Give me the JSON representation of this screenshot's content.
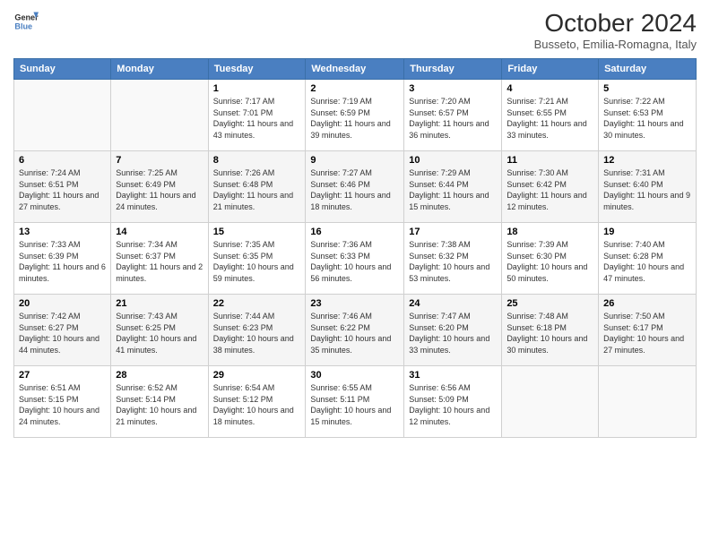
{
  "logo": {
    "line1": "General",
    "line2": "Blue"
  },
  "title": "October 2024",
  "location": "Busseto, Emilia-Romagna, Italy",
  "days_of_week": [
    "Sunday",
    "Monday",
    "Tuesday",
    "Wednesday",
    "Thursday",
    "Friday",
    "Saturday"
  ],
  "weeks": [
    [
      {
        "day": "",
        "info": ""
      },
      {
        "day": "",
        "info": ""
      },
      {
        "day": "1",
        "info": "Sunrise: 7:17 AM\nSunset: 7:01 PM\nDaylight: 11 hours and 43 minutes."
      },
      {
        "day": "2",
        "info": "Sunrise: 7:19 AM\nSunset: 6:59 PM\nDaylight: 11 hours and 39 minutes."
      },
      {
        "day": "3",
        "info": "Sunrise: 7:20 AM\nSunset: 6:57 PM\nDaylight: 11 hours and 36 minutes."
      },
      {
        "day": "4",
        "info": "Sunrise: 7:21 AM\nSunset: 6:55 PM\nDaylight: 11 hours and 33 minutes."
      },
      {
        "day": "5",
        "info": "Sunrise: 7:22 AM\nSunset: 6:53 PM\nDaylight: 11 hours and 30 minutes."
      }
    ],
    [
      {
        "day": "6",
        "info": "Sunrise: 7:24 AM\nSunset: 6:51 PM\nDaylight: 11 hours and 27 minutes."
      },
      {
        "day": "7",
        "info": "Sunrise: 7:25 AM\nSunset: 6:49 PM\nDaylight: 11 hours and 24 minutes."
      },
      {
        "day": "8",
        "info": "Sunrise: 7:26 AM\nSunset: 6:48 PM\nDaylight: 11 hours and 21 minutes."
      },
      {
        "day": "9",
        "info": "Sunrise: 7:27 AM\nSunset: 6:46 PM\nDaylight: 11 hours and 18 minutes."
      },
      {
        "day": "10",
        "info": "Sunrise: 7:29 AM\nSunset: 6:44 PM\nDaylight: 11 hours and 15 minutes."
      },
      {
        "day": "11",
        "info": "Sunrise: 7:30 AM\nSunset: 6:42 PM\nDaylight: 11 hours and 12 minutes."
      },
      {
        "day": "12",
        "info": "Sunrise: 7:31 AM\nSunset: 6:40 PM\nDaylight: 11 hours and 9 minutes."
      }
    ],
    [
      {
        "day": "13",
        "info": "Sunrise: 7:33 AM\nSunset: 6:39 PM\nDaylight: 11 hours and 6 minutes."
      },
      {
        "day": "14",
        "info": "Sunrise: 7:34 AM\nSunset: 6:37 PM\nDaylight: 11 hours and 2 minutes."
      },
      {
        "day": "15",
        "info": "Sunrise: 7:35 AM\nSunset: 6:35 PM\nDaylight: 10 hours and 59 minutes."
      },
      {
        "day": "16",
        "info": "Sunrise: 7:36 AM\nSunset: 6:33 PM\nDaylight: 10 hours and 56 minutes."
      },
      {
        "day": "17",
        "info": "Sunrise: 7:38 AM\nSunset: 6:32 PM\nDaylight: 10 hours and 53 minutes."
      },
      {
        "day": "18",
        "info": "Sunrise: 7:39 AM\nSunset: 6:30 PM\nDaylight: 10 hours and 50 minutes."
      },
      {
        "day": "19",
        "info": "Sunrise: 7:40 AM\nSunset: 6:28 PM\nDaylight: 10 hours and 47 minutes."
      }
    ],
    [
      {
        "day": "20",
        "info": "Sunrise: 7:42 AM\nSunset: 6:27 PM\nDaylight: 10 hours and 44 minutes."
      },
      {
        "day": "21",
        "info": "Sunrise: 7:43 AM\nSunset: 6:25 PM\nDaylight: 10 hours and 41 minutes."
      },
      {
        "day": "22",
        "info": "Sunrise: 7:44 AM\nSunset: 6:23 PM\nDaylight: 10 hours and 38 minutes."
      },
      {
        "day": "23",
        "info": "Sunrise: 7:46 AM\nSunset: 6:22 PM\nDaylight: 10 hours and 35 minutes."
      },
      {
        "day": "24",
        "info": "Sunrise: 7:47 AM\nSunset: 6:20 PM\nDaylight: 10 hours and 33 minutes."
      },
      {
        "day": "25",
        "info": "Sunrise: 7:48 AM\nSunset: 6:18 PM\nDaylight: 10 hours and 30 minutes."
      },
      {
        "day": "26",
        "info": "Sunrise: 7:50 AM\nSunset: 6:17 PM\nDaylight: 10 hours and 27 minutes."
      }
    ],
    [
      {
        "day": "27",
        "info": "Sunrise: 6:51 AM\nSunset: 5:15 PM\nDaylight: 10 hours and 24 minutes."
      },
      {
        "day": "28",
        "info": "Sunrise: 6:52 AM\nSunset: 5:14 PM\nDaylight: 10 hours and 21 minutes."
      },
      {
        "day": "29",
        "info": "Sunrise: 6:54 AM\nSunset: 5:12 PM\nDaylight: 10 hours and 18 minutes."
      },
      {
        "day": "30",
        "info": "Sunrise: 6:55 AM\nSunset: 5:11 PM\nDaylight: 10 hours and 15 minutes."
      },
      {
        "day": "31",
        "info": "Sunrise: 6:56 AM\nSunset: 5:09 PM\nDaylight: 10 hours and 12 minutes."
      },
      {
        "day": "",
        "info": ""
      },
      {
        "day": "",
        "info": ""
      }
    ]
  ]
}
